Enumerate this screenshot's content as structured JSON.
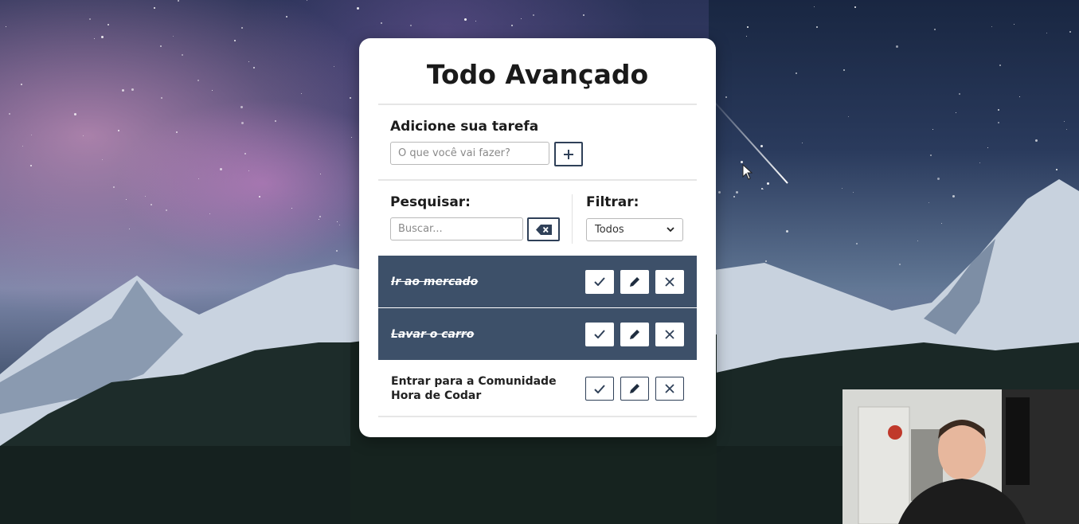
{
  "app": {
    "title": "Todo Avançado"
  },
  "add_form": {
    "label": "Adicione sua tarefa",
    "input_placeholder": "O que você vai fazer?",
    "input_value": "",
    "add_button_icon": "plus-icon"
  },
  "search": {
    "label": "Pesquisar:",
    "placeholder": "Buscar...",
    "value": "",
    "clear_button_icon": "backspace-icon"
  },
  "filter": {
    "label": "Filtrar:",
    "selected": "Todos",
    "icon": "chevron-down-icon"
  },
  "todos": [
    {
      "text": "Ir ao mercado",
      "done": true
    },
    {
      "text": "Lavar o carro",
      "done": true
    },
    {
      "text": "Entrar para a Comunidade Hora de Codar",
      "done": false
    }
  ],
  "todo_actions": {
    "complete_icon": "check-icon",
    "edit_icon": "pencil-icon",
    "remove_icon": "close-icon"
  },
  "colors": {
    "done_row": "#3d5069",
    "button_border": "#2f4058",
    "card": "#ffffff"
  }
}
